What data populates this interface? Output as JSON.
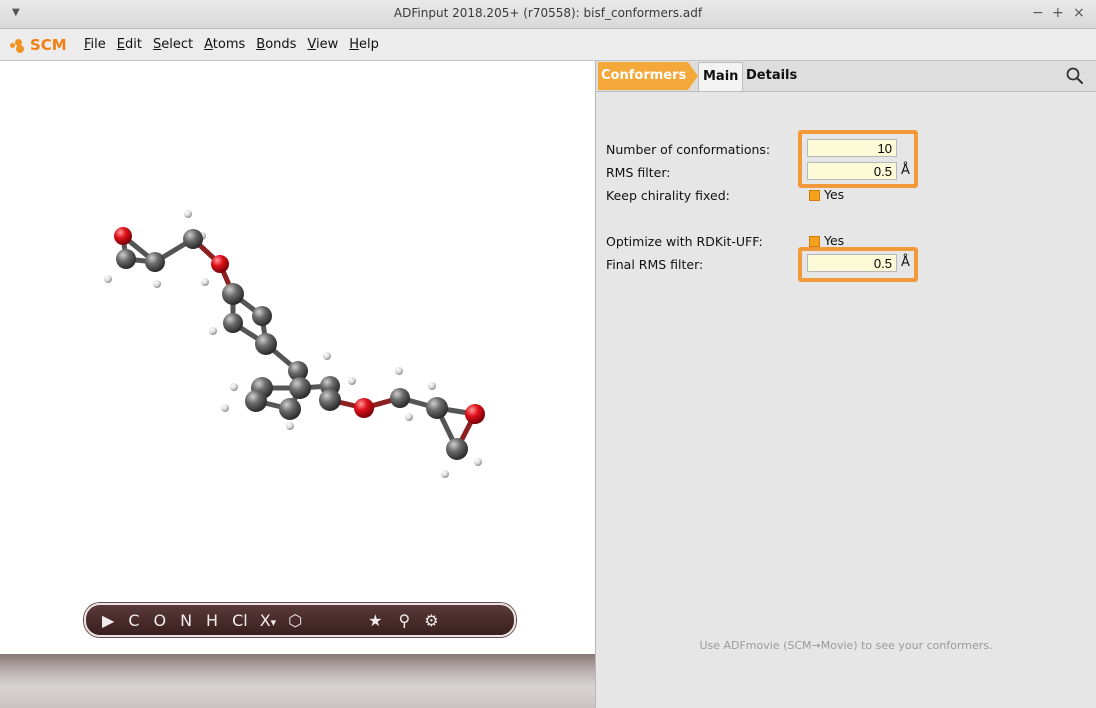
{
  "window": {
    "title": "ADFinput 2018.205+ (r70558): bisf_conformers.adf",
    "controls": [
      "−",
      "+",
      "×"
    ]
  },
  "menubar": {
    "logo_text": "SCM",
    "items": [
      {
        "pre": "",
        "ul": "F",
        "post": "ile"
      },
      {
        "pre": "",
        "ul": "E",
        "post": "dit"
      },
      {
        "pre": "",
        "ul": "S",
        "post": "elect"
      },
      {
        "pre": "",
        "ul": "A",
        "post": "toms"
      },
      {
        "pre": "",
        "ul": "B",
        "post": "onds"
      },
      {
        "pre": "",
        "ul": "V",
        "post": "iew"
      },
      {
        "pre": "",
        "ul": "H",
        "post": "elp"
      }
    ]
  },
  "tabs": {
    "conformers": "Conformers",
    "main": "Main",
    "details": "Details"
  },
  "form": {
    "num_conf_label": "Number of conformations:",
    "num_conf_value": "10",
    "rms_label": "RMS filter:",
    "rms_value": "0.5",
    "rms_unit": "Å",
    "chirality_label": "Keep chirality fixed:",
    "chirality_value": "Yes",
    "optimize_label": "Optimize with RDKit-UFF:",
    "optimize_value": "Yes",
    "final_rms_label": "Final RMS filter:",
    "final_rms_value": "0.5",
    "final_rms_unit": "Å"
  },
  "hint": "Use ADFmovie (SCM→Movie) to see your conformers.",
  "toolbar": {
    "elements": [
      "C",
      "O",
      "N",
      "H",
      "Cl",
      "X"
    ],
    "x_suffix": "▾"
  },
  "colors": {
    "accent": "#f4a83a",
    "highlight": "#f29a3a",
    "field_bg": "#fdfbd7"
  }
}
